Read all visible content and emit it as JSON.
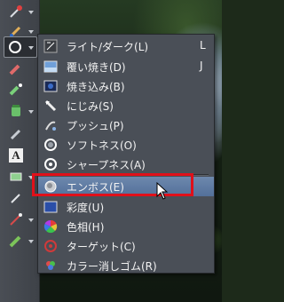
{
  "toolbar": {
    "tools": [
      {
        "name": "eyedropper-tool",
        "icon": "eyedropper-icon"
      },
      {
        "name": "brush-tool",
        "icon": "brush-icon"
      },
      {
        "name": "dodge-tool",
        "icon": "circle-icon"
      },
      {
        "name": "eraser-tool",
        "icon": "eraser-icon"
      },
      {
        "name": "fill-tool",
        "icon": "bucket-icon"
      },
      {
        "name": "paint-tool",
        "icon": "paint-bucket-icon"
      },
      {
        "name": "pencil-tool",
        "icon": "pencil-icon"
      },
      {
        "name": "text-tool",
        "icon": "text-icon"
      },
      {
        "name": "shape-tool",
        "icon": "rectangle-icon"
      },
      {
        "name": "pen-tool",
        "icon": "pen-icon"
      },
      {
        "name": "line-tool",
        "icon": "line-icon"
      },
      {
        "name": "marker-tool",
        "icon": "marker-icon"
      }
    ],
    "text_tool_glyph": "A"
  },
  "menu": {
    "items": [
      {
        "label": "ライト/ダーク(L)",
        "key": "L",
        "icon": "light-dark-icon"
      },
      {
        "label": "覆い焼き(D)",
        "key": "J",
        "icon": "dodge-icon"
      },
      {
        "label": "焼き込み(B)",
        "key": "",
        "icon": "burn-icon"
      },
      {
        "label": "にじみ(S)",
        "key": "",
        "icon": "smudge-icon"
      },
      {
        "label": "プッシュ(P)",
        "key": "",
        "icon": "push-icon"
      },
      {
        "label": "ソフトネス(O)",
        "key": "",
        "icon": "soften-icon"
      },
      {
        "label": "シャープネス(A)",
        "key": "",
        "icon": "sharpen-icon"
      },
      {
        "label": "エンボス(E)",
        "key": "",
        "icon": "emboss-icon",
        "highlighted": true
      },
      {
        "label": "彩度(U)",
        "key": "",
        "icon": "saturation-icon"
      },
      {
        "label": "色相(H)",
        "key": "",
        "icon": "hue-icon"
      },
      {
        "label": "ターゲット(C)",
        "key": "",
        "icon": "target-icon"
      },
      {
        "label": "カラー消しゴム(R)",
        "key": "",
        "icon": "color-eraser-icon"
      }
    ]
  },
  "colors": {
    "highlight": "#5b78a3",
    "menu_bg": "#4a4f57",
    "annotation": "#e0101a"
  }
}
